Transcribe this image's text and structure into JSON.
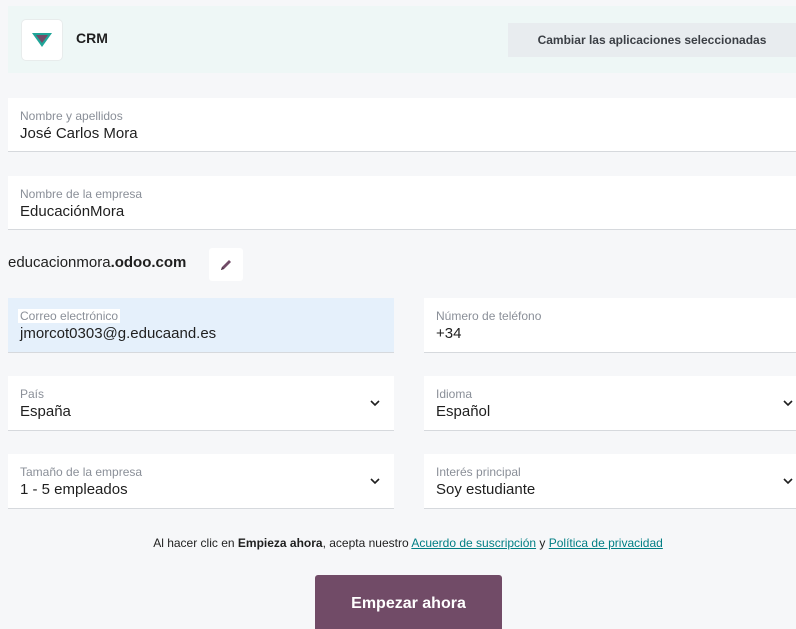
{
  "header": {
    "app_name": "CRM",
    "change_apps_label": "Cambiar las aplicaciones seleccionadas"
  },
  "form": {
    "full_name": {
      "label": "Nombre y apellidos",
      "value": "José Carlos Mora"
    },
    "company_name": {
      "label": "Nombre de la empresa",
      "value": "EducaciónMora"
    },
    "domain": {
      "prefix": "educacionmora",
      "suffix": ".odoo.com"
    },
    "email": {
      "label": "Correo electrónico",
      "value": "jmorcot0303@g.educaand.es"
    },
    "phone": {
      "label": "Número de teléfono",
      "value": "+34"
    },
    "country": {
      "label": "País",
      "value": "España"
    },
    "language": {
      "label": "Idioma",
      "value": "Español"
    },
    "company_size": {
      "label": "Tamaño de la empresa",
      "value": "1 - 5 empleados"
    },
    "main_interest": {
      "label": "Interés principal",
      "value": "Soy estudiante"
    }
  },
  "terms": {
    "prefix": "Al hacer clic en ",
    "bold": "Empieza ahora",
    "middle": ", acepta nuestro ",
    "subscription_link": "Acuerdo de suscripción",
    "conjunction": " y ",
    "privacy_link": "Política de privacidad"
  },
  "start_button_label": "Empezar ahora",
  "colors": {
    "brand": "#714b67",
    "link": "#017e84",
    "header_bg": "#eef7f6",
    "focused_field_bg": "#e5f0fb"
  },
  "icons": {
    "logo": "crm-logo-icon",
    "edit": "pencil-icon",
    "dropdown": "chevron-down-icon"
  }
}
